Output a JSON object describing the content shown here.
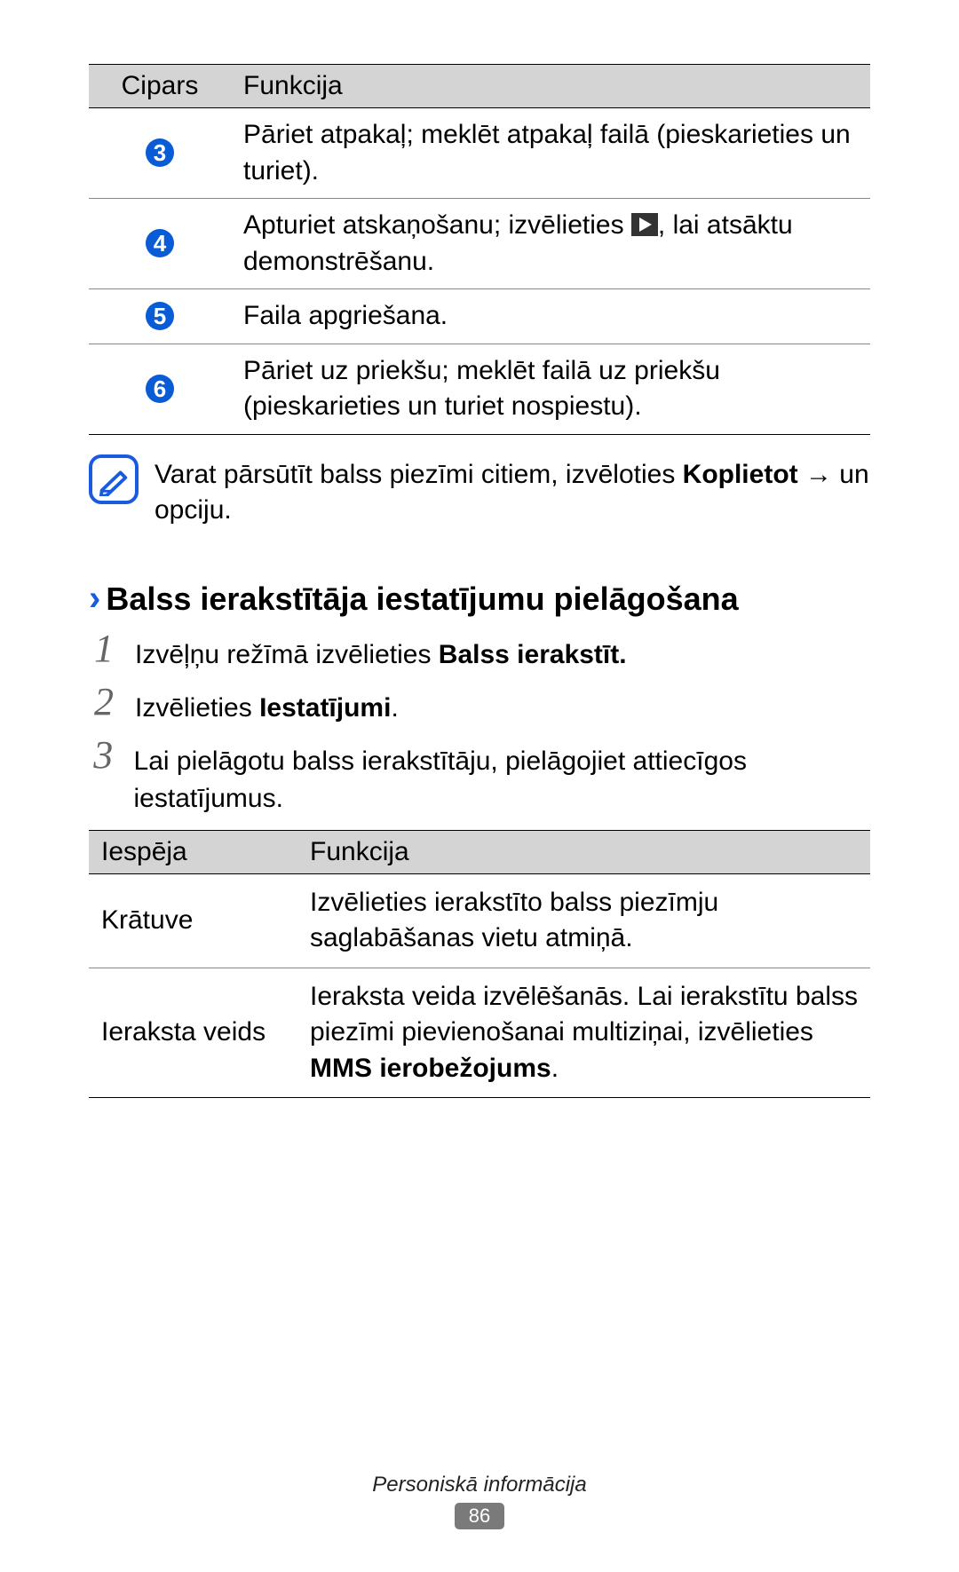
{
  "table1": {
    "headers": {
      "num": "Cipars",
      "func": "Funkcija"
    },
    "rows": [
      {
        "badge": "3",
        "text_a": "Pāriet atpakaļ; meklēt atpakaļ failā (pieskarieties un turiet)."
      },
      {
        "badge": "4",
        "text_a": "Apturiet atskaņošanu; izvēlieties ",
        "text_b": ", lai atsāktu demonstrēšanu.",
        "has_icon": true
      },
      {
        "badge": "5",
        "text_a": "Faila apgriešana."
      },
      {
        "badge": "6",
        "text_a": "Pāriet uz priekšu; meklēt failā uz priekšu (pieskarieties un turiet nospiestu)."
      }
    ]
  },
  "note": {
    "text_a": "Varat pārsūtīt balss piezīmi citiem, izvēloties ",
    "bold": "Koplietot",
    "text_b": " → un opciju."
  },
  "section": {
    "chevron": "›",
    "title": "Balss ierakstītāja iestatījumu pielāgošana"
  },
  "steps": [
    {
      "num": "1",
      "text_a": "Izvēļņu režīmā izvēlieties ",
      "bold": "Balss ierakstīt."
    },
    {
      "num": "2",
      "text_a": "Izvēlieties ",
      "bold": "Iestatījumi",
      "text_b": "."
    },
    {
      "num": "3",
      "text_a": "Lai pielāgotu balss ierakstītāju, pielāgojiet attiecīgos iestatījumus."
    }
  ],
  "table2": {
    "headers": {
      "opt": "Iespēja",
      "func": "Funkcija"
    },
    "rows": [
      {
        "opt": "Krātuve",
        "func_a": "Izvēlieties ierakstīto balss piezīmju saglabāšanas vietu atmiņā."
      },
      {
        "opt": "Ieraksta veids",
        "func_a": "Ieraksta veida izvēlēšanās. Lai ierakstītu balss piezīmi pievienošanai multiziņai, izvēlieties ",
        "bold": "MMS ierobežojums",
        "func_b": "."
      }
    ]
  },
  "footer": {
    "label": "Personiskā informācija",
    "page": "86"
  }
}
